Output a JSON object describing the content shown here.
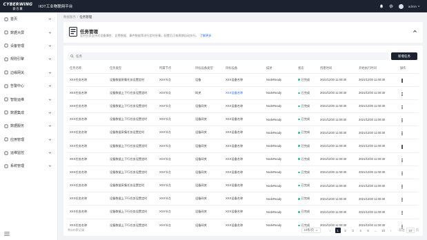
{
  "topbar": {
    "logo_main": "CYBERWING",
    "logo_sub": "赛百翼",
    "app_title": "IIOT工业物联网平台",
    "username": "admin"
  },
  "sidebar": {
    "items": [
      {
        "label": "首页",
        "icon": "home-icon"
      },
      {
        "label": "数据大屏",
        "icon": "screen-icon"
      },
      {
        "label": "设备管理",
        "icon": "device-icon"
      },
      {
        "label": "规则引擎",
        "icon": "rule-icon"
      },
      {
        "label": "边缘网关",
        "icon": "gateway-icon"
      },
      {
        "label": "告警中心",
        "icon": "alarm-icon"
      },
      {
        "label": "智能运维",
        "icon": "ops-icon"
      },
      {
        "label": "数据集成",
        "icon": "integration-icon"
      },
      {
        "label": "数据服务",
        "icon": "service-icon"
      },
      {
        "label": "应用管理",
        "icon": "app-icon"
      },
      {
        "label": "运维监控",
        "icon": "monitor-icon"
      },
      {
        "label": "系统管理",
        "icon": "settings-icon"
      }
    ]
  },
  "breadcrumb": {
    "parent": "数据服务",
    "separator": "/",
    "current": "任务管理"
  },
  "header": {
    "title": "任务管理",
    "description": "定时任务支持对设备属性、告警数据、事件数据等进行定时采集，配置后可按周期自动执行。",
    "link": "了解更多"
  },
  "search": {
    "placeholder": "任务"
  },
  "new_button": "新增任务",
  "table": {
    "columns": [
      "任务名称",
      "任务类型",
      "所属节点",
      "目标设备类型",
      "目标设备",
      "描述",
      "状态",
      "创建时间",
      "开始执行时间",
      "操作"
    ],
    "rows": [
      [
        "XXX任务名称",
        "设备数据采集任务设置定时",
        "XXX节点",
        "设备",
        "XXX设备名称",
        "NodeReady",
        "已完成",
        "2021/12/30 11:00:30",
        "2021/12/30 11:00:30"
      ],
      [
        "XXX任务名称",
        "设备数据上下行任务设置定时",
        "XXX节点",
        "网关",
        "XXX设备名称",
        "NodeReady",
        "已完成",
        "2021/12/30 11:00:30",
        "2021/12/30 11:00:30"
      ],
      [
        "XXX任务名称",
        "设备数据上下行任务设置定时",
        "XXX节点",
        "设备网关",
        "XXX设备名称",
        "NodeReady",
        "已完成",
        "2021/12/30 11:00:30",
        "2021/12/30 11:00:30"
      ],
      [
        "XXX任务名称",
        "设备数据上下行任务设置定时",
        "XXX节点",
        "设备网关",
        "XXX设备名称",
        "NodeReady",
        "已完成",
        "2021/12/30 11:00:30",
        "2021/12/30 11:00:30"
      ],
      [
        "XXX任务名称",
        "设备数据采集任务设置定时",
        "XXX节点",
        "设备网关",
        "XXX设备名称",
        "NodeReady",
        "已完成",
        "2021/12/30 11:00:30",
        "2021/12/30 11:00:30"
      ],
      [
        "XXX任务名称",
        "设备数据上下行任务设置定时",
        "XXX节点",
        "设备网关",
        "XXX设备名称",
        "NodeReady",
        "已完成",
        "2021/12/30 11:00:30",
        "2021/12/30 11:00:30"
      ],
      [
        "XXX任务名称",
        "设备数据上下行任务设置定时",
        "XXX节点",
        "设备网关",
        "XXX设备名称",
        "NodeReady",
        "已完成",
        "2021/12/30 11:00:30",
        "2021/12/30 11:00:30"
      ],
      [
        "XXX任务名称",
        "设备数据上下行任务设置定时",
        "XXX节点",
        "设备网关",
        "XXX设备名称",
        "NodeReady",
        "已完成",
        "2021/12/30 11:00:30",
        "2021/12/30 11:00:30"
      ],
      [
        "XXX任务名称",
        "设备数据采集任务设置定时",
        "XXX节点",
        "设备网关",
        "XXX设备名称",
        "NodeReady",
        "已完成",
        "2021/12/30 11:00:30",
        "2021/12/30 11:00:30"
      ],
      [
        "XXX任务名称",
        "设备数据上下行任务设置定时",
        "XXX节点",
        "设备网关",
        "XXX设备名称",
        "NodeReady",
        "已完成",
        "2021/12/30 11:00:30",
        "2021/12/30 11:00:30"
      ],
      [
        "XXX任务名称",
        "设备数据上下行任务设置定时",
        "XXX节点",
        "设备网关",
        "XXX设备名称",
        "NodeReady",
        "已完成",
        "2021/12/30 11:00:30",
        "2021/12/30 11:00:30"
      ],
      [
        "XXX任务名称",
        "设备数据上下行任务设置定时",
        "XXX节点",
        "设备网关",
        "XXX设备名称",
        "NodeReady",
        "已完成",
        "2021/12/30 11:00:30",
        "2021/12/30 11:00:30"
      ]
    ],
    "blue_target_row": 1,
    "status_color": "#2ec27e"
  },
  "pager": {
    "total": "共100条记录",
    "page_size": "10条/页",
    "pages": [
      "1",
      "2",
      "3",
      "4",
      "5",
      "...",
      "10"
    ],
    "active_page": "1",
    "jump_label": "前往",
    "jump_value": "10",
    "jump_suffix": "页"
  },
  "colors": {
    "brand_dark": "#1c2230",
    "link": "#2f6bff",
    "success": "#2ec27e"
  }
}
